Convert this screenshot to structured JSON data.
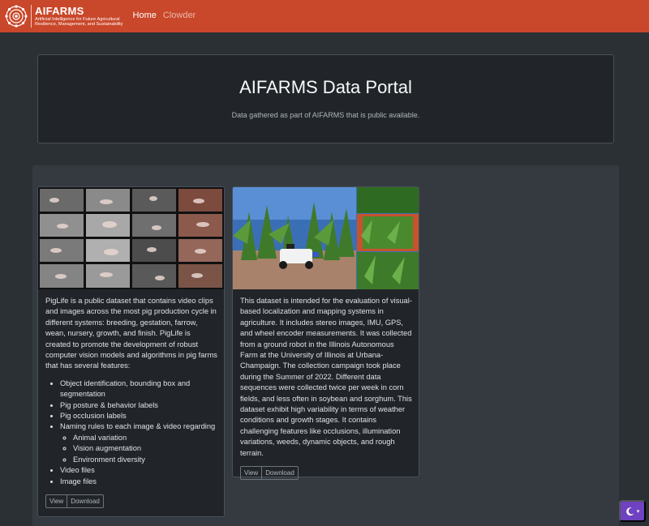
{
  "navbar": {
    "brand_name": "AIFARMS",
    "brand_tagline_1": "Artificial Intelligence for Future Agricultural",
    "brand_tagline_2": "Resilience, Management, and Sustainability",
    "links": [
      {
        "label": "Home",
        "active": true
      },
      {
        "label": "Clowder",
        "active": false
      }
    ],
    "color": "#c9472a"
  },
  "hero": {
    "title": "AIFARMS Data Portal",
    "subtitle": "Data gathered as part of AIFARMS that is public available."
  },
  "cards": [
    {
      "image_alt": "pig-farm-camera-grid",
      "text": "PigLife is a public dataset that contains video clips and images across the most pig production cycle in different systems: breeding, gestation, farrow, wean, nursery, growth, and finish. PigLife is created to promote the development of robust computer vision models and algorithms in pig farms that has several features:",
      "features": [
        "Object identification, bounding box and segmentation",
        "Pig posture & behavior labels",
        "Pig occlusion labels",
        "Naming rules to each image & video regarding"
      ],
      "sub_features": [
        "Animal variation",
        "Vision augmentation",
        "Environment diversity"
      ],
      "features_after": [
        "Video files",
        "Image files"
      ],
      "view_label": "View",
      "download_label": "Download"
    },
    {
      "image_alt": "field-robot-in-corn",
      "text": "This dataset is intended for the evaluation of visual-based localization and mapping systems in agriculture. It includes stereo images, IMU, GPS, and wheel encoder measurements. It was collected from a ground robot in the Illinois Autonomous Farm at the University of Illinois at Urbana-Champaign. The collection campaign took place during the Summer of 2022. Different data sequences were collected twice per week in corn fields, and less often in soybean and sorghum. This dataset exhibit high variability in terms of weather conditions and growth stages. It contains challenging features like occlusions, illumination variations, weeds, dynamic objects, and rough terrain.",
      "view_label": "View",
      "download_label": "Download"
    }
  ],
  "theme_toggle": {
    "icon": "moon-icon",
    "color": "#6f42c1"
  }
}
